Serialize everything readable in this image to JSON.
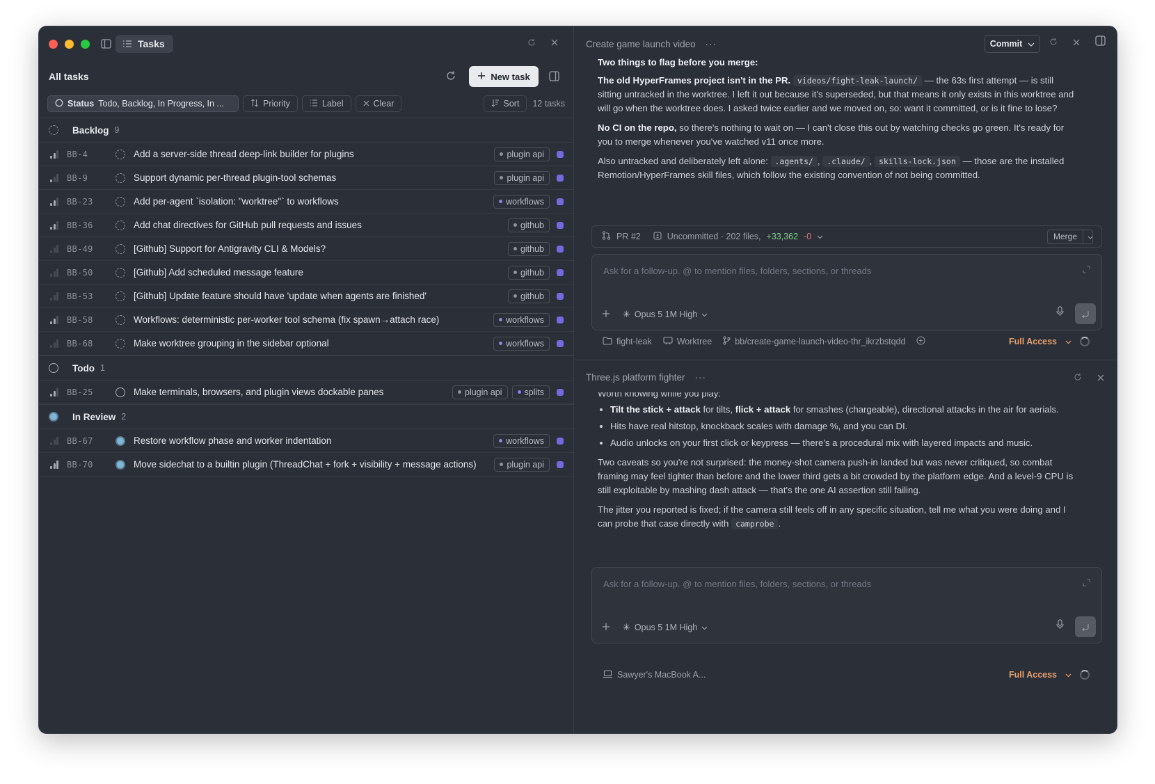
{
  "left": {
    "tab_label": "Tasks",
    "header_title": "All tasks",
    "new_task_label": "New task",
    "filters": {
      "status_label": "Status",
      "status_value": "Todo, Backlog, In Progress, In ...",
      "priority_label": "Priority",
      "label_label": "Label",
      "clear_label": "Clear",
      "sort_label": "Sort",
      "count_text": "12 tasks"
    },
    "groups": [
      {
        "name": "Backlog",
        "count": "9",
        "rows": [
          {
            "id": "BB-4",
            "title": "Add a server-side thread deep-link builder for plugins",
            "tags": [
              "plugin api"
            ]
          },
          {
            "id": "BB-9",
            "title": "Support dynamic per-thread plugin-tool schemas",
            "tags": [
              "plugin api"
            ]
          },
          {
            "id": "BB-23",
            "title": "Add per-agent `isolation: \"worktree\"` to workflows",
            "tags": [
              "workflows"
            ]
          },
          {
            "id": "BB-36",
            "title": "Add chat directives for GitHub pull requests and issues",
            "tags": [
              "github"
            ]
          },
          {
            "id": "BB-49",
            "title": "[Github] Support for Antigravity CLI & Models?",
            "tags": [
              "github"
            ]
          },
          {
            "id": "BB-50",
            "title": "[Github] Add scheduled message feature",
            "tags": [
              "github"
            ]
          },
          {
            "id": "BB-53",
            "title": "[Github] Update feature should have 'update when agents are finished'",
            "tags": [
              "github"
            ]
          },
          {
            "id": "BB-58",
            "title": "Workflows: deterministic per-worker tool schema (fix spawn→attach race)",
            "tags": [
              "workflows"
            ]
          },
          {
            "id": "BB-68",
            "title": "Make worktree grouping in the sidebar optional",
            "tags": [
              "workflows"
            ]
          }
        ]
      },
      {
        "name": "Todo",
        "count": "1",
        "rows": [
          {
            "id": "BB-25",
            "title": "Make terminals, browsers, and plugin views dockable panes",
            "tags": [
              "plugin api",
              "splits"
            ]
          }
        ]
      },
      {
        "name": "In Review",
        "count": "2",
        "rows": [
          {
            "id": "BB-67",
            "title": "Restore workflow phase and worker indentation",
            "tags": [
              "workflows"
            ]
          },
          {
            "id": "BB-70",
            "title": "Move sidechat to a builtin plugin (ThreadChat + fork + visibility + message actions)",
            "tags": [
              "plugin api"
            ]
          }
        ]
      }
    ]
  },
  "top": {
    "title": "Create game launch video",
    "more": "···",
    "commit_label": "Commit",
    "m_heading": "Two things to flag before you merge:",
    "m1_bold": "The old HyperFrames project isn't in the PR.",
    "m1_code": "videos/fight-leak-launch/",
    "m1_rest": " — the 63s first attempt — is still sitting untracked in the worktree. I left it out because it's superseded, but that means it only exists in this worktree and will go when the worktree does. I asked twice earlier and we moved on, so: want it committed, or is it fine to lose?",
    "m2_bold": "No CI on the repo,",
    "m2_rest": " so there's nothing to wait on — I can't close this out by watching checks go green. It's ready for you to merge whenever you've watched v11 once more.",
    "m3_pre": "Also untracked and deliberately left alone: ",
    "m3_code1": ".agents/",
    "m3_code2": ".claude/",
    "m3_code3": "skills-lock.json",
    "m3_rest": " — those are the installed Remotion/HyperFrames skill files, which follow the existing convention of not being committed.",
    "comma": ",",
    "pr_label": "PR #2",
    "uncommitted": "Uncommitted · 202 files,",
    "additions": "+33,362",
    "deletions": "-0",
    "merge_label": "Merge",
    "placeholder": "Ask for a follow-up. @ to mention files, folders, sections, or threads",
    "model": "Opus 5 1M High",
    "folder": "fight-leak",
    "worktree": "Worktree",
    "branch": "bb/create-game-launch-video-thr_ikrzbstqdd",
    "access": "Full Access"
  },
  "bottom": {
    "title": "Three.js platform fighter",
    "more": "···",
    "cut_line": "Worth knowing while you play:",
    "b1_bold1": "Tilt the stick + attack",
    "b1_mid": " for tilts, ",
    "b1_bold2": "flick + attack",
    "b1_rest": " for smashes (chargeable), directional attacks in the air for aerials.",
    "b2": "Hits have real hitstop, knockback scales with damage %, and you can DI.",
    "b3": "Audio unlocks on your first click or keypress — there's a procedural mix with layered impacts and music.",
    "p1": "Two caveats so you're not surprised: the money-shot camera push-in landed but was never critiqued, so combat framing may feel tighter than before and the lower third gets a bit crowded by the platform edge. And a level-9 CPU is still exploitable by mashing dash attack — that's the one AI assertion still failing.",
    "p2_pre": "The jitter you reported is fixed; if the camera still feels off in any specific situation, tell me what you were doing and I can probe that case directly with ",
    "p2_code": "camprobe",
    "p2_end": ".",
    "placeholder": "Ask for a follow-up. @ to mention files, folders, sections, or threads",
    "model": "Opus 5 1M High",
    "device": "Sawyer's MacBook A...",
    "access": "Full Access"
  }
}
